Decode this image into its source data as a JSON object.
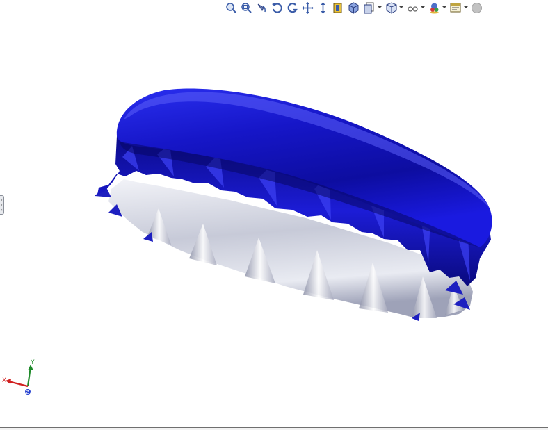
{
  "toolbar": {
    "items": [
      {
        "name": "zoom-to-fit-icon"
      },
      {
        "name": "zoom-to-area-icon"
      },
      {
        "name": "previous-view-icon"
      },
      {
        "name": "rotate-view-icon"
      },
      {
        "name": "section-view-icon"
      },
      {
        "name": "pan-icon"
      },
      {
        "name": "zoom-in-out-icon"
      },
      {
        "name": "dynamic-annotation-icon"
      },
      {
        "name": "view-orientation-icon"
      },
      {
        "name": "display-style-icon",
        "dropdown": true
      },
      {
        "name": "hide-show-items-icon",
        "dropdown": true
      },
      {
        "name": "edit-appearance-icon",
        "dropdown": true
      },
      {
        "name": "apply-scene-icon",
        "dropdown": true
      },
      {
        "name": "view-settings-icon",
        "dropdown": true
      },
      {
        "name": "record-status-icon"
      }
    ]
  },
  "triad": {
    "x_label": "X",
    "y_label": "Y",
    "z_label": "Z"
  },
  "colors": {
    "cap_top": "#1a1adf",
    "cap_inner": "#c9cdda",
    "axis_x": "#d12020",
    "axis_y": "#1f8a2a",
    "axis_z": "#2540d0"
  }
}
